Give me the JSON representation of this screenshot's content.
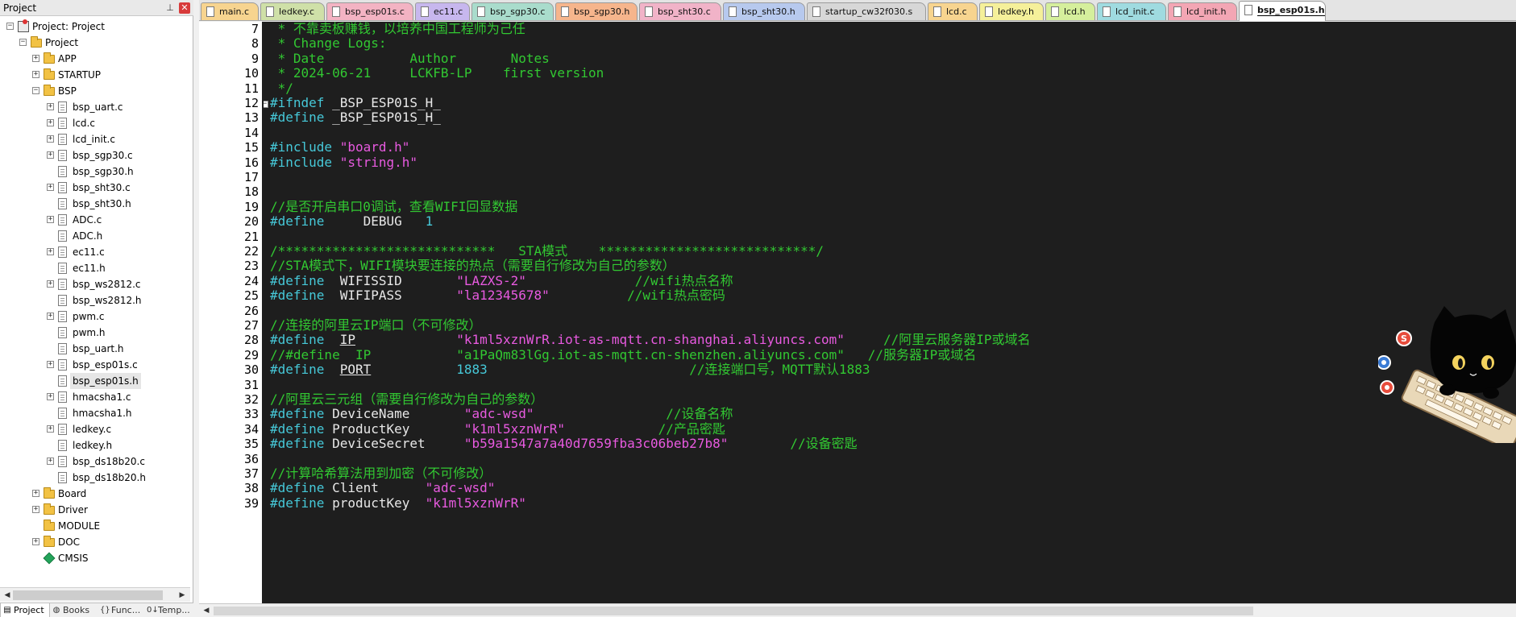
{
  "panel": {
    "title": "Project",
    "tree": [
      {
        "label": "Project: Project",
        "indent": 0,
        "icon": "proj",
        "exp": "-"
      },
      {
        "label": "Project",
        "indent": 1,
        "icon": "folder",
        "exp": "-"
      },
      {
        "label": "APP",
        "indent": 2,
        "icon": "folder",
        "exp": "+"
      },
      {
        "label": "STARTUP",
        "indent": 2,
        "icon": "folder",
        "exp": "+"
      },
      {
        "label": "BSP",
        "indent": 2,
        "icon": "folder",
        "exp": "-"
      },
      {
        "label": "bsp_uart.c",
        "indent": 3,
        "icon": "file",
        "exp": "+"
      },
      {
        "label": "lcd.c",
        "indent": 3,
        "icon": "file",
        "exp": "+"
      },
      {
        "label": "lcd_init.c",
        "indent": 3,
        "icon": "file",
        "exp": "+"
      },
      {
        "label": "bsp_sgp30.c",
        "indent": 3,
        "icon": "file",
        "exp": "+"
      },
      {
        "label": "bsp_sgp30.h",
        "indent": 3,
        "icon": "file",
        "exp": ""
      },
      {
        "label": "bsp_sht30.c",
        "indent": 3,
        "icon": "file",
        "exp": "+"
      },
      {
        "label": "bsp_sht30.h",
        "indent": 3,
        "icon": "file",
        "exp": ""
      },
      {
        "label": "ADC.c",
        "indent": 3,
        "icon": "file",
        "exp": "+"
      },
      {
        "label": "ADC.h",
        "indent": 3,
        "icon": "file",
        "exp": ""
      },
      {
        "label": "ec11.c",
        "indent": 3,
        "icon": "file",
        "exp": "+"
      },
      {
        "label": "ec11.h",
        "indent": 3,
        "icon": "file",
        "exp": ""
      },
      {
        "label": "bsp_ws2812.c",
        "indent": 3,
        "icon": "file",
        "exp": "+"
      },
      {
        "label": "bsp_ws2812.h",
        "indent": 3,
        "icon": "file",
        "exp": ""
      },
      {
        "label": "pwm.c",
        "indent": 3,
        "icon": "file",
        "exp": "+"
      },
      {
        "label": "pwm.h",
        "indent": 3,
        "icon": "file",
        "exp": ""
      },
      {
        "label": "bsp_uart.h",
        "indent": 3,
        "icon": "file",
        "exp": ""
      },
      {
        "label": "bsp_esp01s.c",
        "indent": 3,
        "icon": "file",
        "exp": "+"
      },
      {
        "label": "bsp_esp01s.h",
        "indent": 3,
        "icon": "file",
        "exp": "",
        "selected": true
      },
      {
        "label": "hmacsha1.c",
        "indent": 3,
        "icon": "file",
        "exp": "+"
      },
      {
        "label": "hmacsha1.h",
        "indent": 3,
        "icon": "file",
        "exp": ""
      },
      {
        "label": "ledkey.c",
        "indent": 3,
        "icon": "file",
        "exp": "+"
      },
      {
        "label": "ledkey.h",
        "indent": 3,
        "icon": "file",
        "exp": ""
      },
      {
        "label": "bsp_ds18b20.c",
        "indent": 3,
        "icon": "file",
        "exp": "+"
      },
      {
        "label": "bsp_ds18b20.h",
        "indent": 3,
        "icon": "file",
        "exp": ""
      },
      {
        "label": "Board",
        "indent": 2,
        "icon": "folder",
        "exp": "+"
      },
      {
        "label": "Driver",
        "indent": 2,
        "icon": "folder",
        "exp": "+"
      },
      {
        "label": "MODULE",
        "indent": 2,
        "icon": "folder",
        "exp": ""
      },
      {
        "label": "DOC",
        "indent": 2,
        "icon": "folder",
        "exp": "+"
      },
      {
        "label": "CMSIS",
        "indent": 2,
        "icon": "gem",
        "exp": ""
      }
    ],
    "bottom_tabs": [
      {
        "label": "Project",
        "icon": "project-icon",
        "glyph": "▤",
        "active": true
      },
      {
        "label": "Books",
        "icon": "books-icon",
        "glyph": "◍",
        "active": false
      },
      {
        "label": "Func...",
        "icon": "functions-icon",
        "glyph": "{}",
        "active": false
      },
      {
        "label": "Temp...",
        "icon": "templates-icon",
        "glyph": "0↓",
        "active": false
      }
    ]
  },
  "editor_tabs": [
    {
      "label": "main.c",
      "color": "#f7d48f",
      "width": 74
    },
    {
      "label": "ledkey.c",
      "color": "#cfe0a8",
      "width": 82
    },
    {
      "label": "bsp_esp01s.c",
      "color": "#f3b3c3",
      "width": 110
    },
    {
      "label": "ec11.c",
      "color": "#c7b7ee",
      "width": 70
    },
    {
      "label": "bsp_sgp30.c",
      "color": "#a9dccc",
      "width": 104
    },
    {
      "label": "bsp_sgp30.h",
      "color": "#f6b58c",
      "width": 104
    },
    {
      "label": "bsp_sht30.c",
      "color": "#f1b3c8",
      "width": 104
    },
    {
      "label": "bsp_sht30.h",
      "color": "#b7c9ee",
      "width": 104
    },
    {
      "label": "startup_cw32f030.s",
      "color": "#d7d7d7",
      "width": 150
    },
    {
      "label": "lcd.c",
      "color": "#f7d48f",
      "width": 64
    },
    {
      "label": "ledkey.h",
      "color": "#f5f09a",
      "width": 82
    },
    {
      "label": "lcd.h",
      "color": "#d5ef9c",
      "width": 64
    },
    {
      "label": "lcd_init.c",
      "color": "#9fdbe0",
      "width": 88
    },
    {
      "label": "lcd_init.h",
      "color": "#f3a6b4",
      "width": 88
    },
    {
      "label": "bsp_esp01s.h",
      "color": "#ffffff",
      "width": 110,
      "active": true
    }
  ],
  "code": {
    "lines": [
      {
        "n": "7",
        "t": [
          [
            " * 不靠卖板赚钱，以培养中国工程师为己任",
            "cm"
          ]
        ]
      },
      {
        "n": "8",
        "t": [
          [
            " * Change Logs:",
            "cm"
          ]
        ]
      },
      {
        "n": "9",
        "t": [
          [
            " * Date           Author       Notes",
            "cm"
          ]
        ]
      },
      {
        "n": "10",
        "t": [
          [
            " * 2024-06-21     LCKFB-LP    first version",
            "cm"
          ]
        ]
      },
      {
        "n": "11",
        "t": [
          [
            " */",
            "cm"
          ]
        ]
      },
      {
        "n": "12",
        "t": [
          [
            "#ifndef",
            "pp"
          ],
          [
            " _BSP_ESP01S_H_",
            "id"
          ]
        ],
        "fold": "-"
      },
      {
        "n": "13",
        "t": [
          [
            "#define",
            "pp"
          ],
          [
            " _BSP_ESP01S_H_",
            "id"
          ]
        ]
      },
      {
        "n": "14",
        "t": []
      },
      {
        "n": "15",
        "t": [
          [
            "#include",
            "pp"
          ],
          [
            " ",
            "id"
          ],
          [
            "\"board.h\"",
            "str"
          ]
        ]
      },
      {
        "n": "16",
        "t": [
          [
            "#include",
            "pp"
          ],
          [
            " ",
            "id"
          ],
          [
            "\"string.h\"",
            "str"
          ]
        ]
      },
      {
        "n": "17",
        "t": []
      },
      {
        "n": "18",
        "t": []
      },
      {
        "n": "19",
        "t": [
          [
            "//是否开启串口0调试，查看WIFI回显数据",
            "cm"
          ]
        ]
      },
      {
        "n": "20",
        "t": [
          [
            "#define",
            "pp"
          ],
          [
            "     DEBUG   ",
            "id"
          ],
          [
            "1",
            "num"
          ]
        ]
      },
      {
        "n": "21",
        "t": []
      },
      {
        "n": "22",
        "t": [
          [
            "/****************************   STA模式    ****************************/",
            "cm"
          ]
        ]
      },
      {
        "n": "23",
        "t": [
          [
            "//STA模式下，WIFI模块要连接的热点（需要自行修改为自己的参数）",
            "cm"
          ]
        ]
      },
      {
        "n": "24",
        "t": [
          [
            "#define",
            "pp"
          ],
          [
            "  WIFISSID       ",
            "id"
          ],
          [
            "\"LAZXS-2\"",
            "str"
          ],
          [
            "              //wifi热点名称",
            "cm"
          ]
        ]
      },
      {
        "n": "25",
        "t": [
          [
            "#define",
            "pp"
          ],
          [
            "  WIFIPASS       ",
            "id"
          ],
          [
            "\"la12345678\"",
            "str"
          ],
          [
            "          //wifi热点密码",
            "cm"
          ]
        ]
      },
      {
        "n": "26",
        "t": []
      },
      {
        "n": "27",
        "t": [
          [
            "//连接的阿里云IP端口（不可修改）",
            "cm"
          ]
        ]
      },
      {
        "n": "28",
        "t": [
          [
            "#define",
            "pp"
          ],
          [
            "  ",
            "id"
          ],
          [
            "IP",
            "idu"
          ],
          [
            "             ",
            "id"
          ],
          [
            "\"k1ml5xznWrR.iot-as-mqtt.cn-shanghai.aliyuncs.com\"",
            "str"
          ],
          [
            "     //阿里云服务器IP或域名",
            "cm"
          ]
        ]
      },
      {
        "n": "29",
        "t": [
          [
            "//#define  IP           \"a1PaQm83lGg.iot-as-mqtt.cn-shenzhen.aliyuncs.com\"   //服务器IP或域名",
            "cm"
          ]
        ]
      },
      {
        "n": "30",
        "t": [
          [
            "#define",
            "pp"
          ],
          [
            "  ",
            "id"
          ],
          [
            "PORT",
            "idu"
          ],
          [
            "           ",
            "id"
          ],
          [
            "1883",
            "num"
          ],
          [
            "                          //连接端口号，MQTT默认1883",
            "cm"
          ]
        ]
      },
      {
        "n": "31",
        "t": []
      },
      {
        "n": "32",
        "t": [
          [
            "//阿里云三元组（需要自行修改为自己的参数）",
            "cm"
          ]
        ]
      },
      {
        "n": "33",
        "t": [
          [
            "#define",
            "pp"
          ],
          [
            " DeviceName       ",
            "id"
          ],
          [
            "\"adc-wsd\"",
            "str"
          ],
          [
            "                 //设备名称",
            "cm"
          ]
        ]
      },
      {
        "n": "34",
        "t": [
          [
            "#define",
            "pp"
          ],
          [
            " ProductKey       ",
            "id"
          ],
          [
            "\"k1ml5xznWrR\"",
            "str"
          ],
          [
            "            //产品密匙",
            "cm"
          ]
        ]
      },
      {
        "n": "35",
        "t": [
          [
            "#define",
            "pp"
          ],
          [
            " DeviceSecret     ",
            "id"
          ],
          [
            "\"b59a1547a7a40d7659fba3c06beb27b8\"",
            "str"
          ],
          [
            "        //设备密匙",
            "cm"
          ]
        ]
      },
      {
        "n": "36",
        "t": []
      },
      {
        "n": "37",
        "t": [
          [
            "//计算哈希算法用到加密（不可修改）",
            "cm"
          ]
        ]
      },
      {
        "n": "38",
        "t": [
          [
            "#define",
            "pp"
          ],
          [
            " Client      ",
            "id"
          ],
          [
            "\"adc-wsd\"",
            "str"
          ]
        ]
      },
      {
        "n": "39",
        "t": [
          [
            "#define",
            "pp"
          ],
          [
            " productKey  ",
            "id"
          ],
          [
            "\"k1ml5xznWrR\"",
            "str"
          ]
        ]
      }
    ]
  }
}
